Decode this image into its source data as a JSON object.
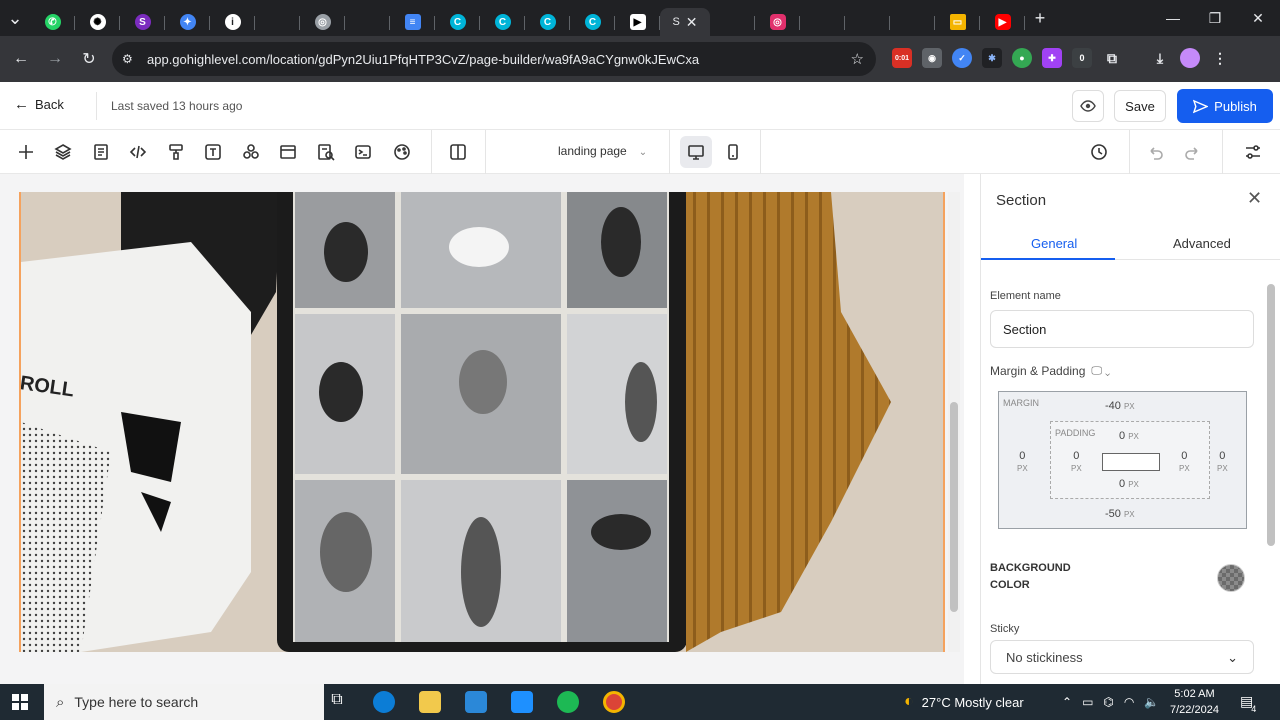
{
  "browser": {
    "url": "app.gohighlevel.com/location/gdPyn2Uiu1PfqHTP3CvZ/page-builder/wa9fA9aCYgnw0kJEwCxa",
    "tab_active_glyph": "S",
    "new_tab": "+",
    "ext_badge_1": "0:01",
    "ext_badge_2": "0"
  },
  "header": {
    "back_label": "Back",
    "last_saved": "Last saved 13 hours ago",
    "save_label": "Save",
    "publish_label": "Publish"
  },
  "toolbar": {
    "page_select": "landing page"
  },
  "panel": {
    "title": "Section",
    "tabs": [
      {
        "label": "General"
      },
      {
        "label": "Advanced"
      }
    ],
    "element_name_label": "Element name",
    "element_name_value": "Section",
    "margin_padding_label": "Margin & Padding",
    "margin_label": "MARGIN",
    "padding_label": "PADDING",
    "margin": {
      "top": "-40",
      "right": "0",
      "bottom": "-50",
      "left": "0"
    },
    "padding": {
      "top": "0",
      "right": "0",
      "bottom": "0",
      "left": "0"
    },
    "unit": "PX",
    "background_label_1": "BACKGROUND",
    "background_label_2": "COLOR",
    "sticky_label": "Sticky",
    "sticky_value": "No stickiness"
  },
  "taskbar": {
    "search_placeholder": "Type here to search",
    "weather": "27°C  Mostly clear",
    "time": "5:02 AM",
    "date": "7/22/2024",
    "notif_count": "4"
  },
  "canvas": {
    "tshirt_text": "ROLL"
  },
  "colors": {
    "accent": "#155eef",
    "section_border": "#f5a25d"
  }
}
